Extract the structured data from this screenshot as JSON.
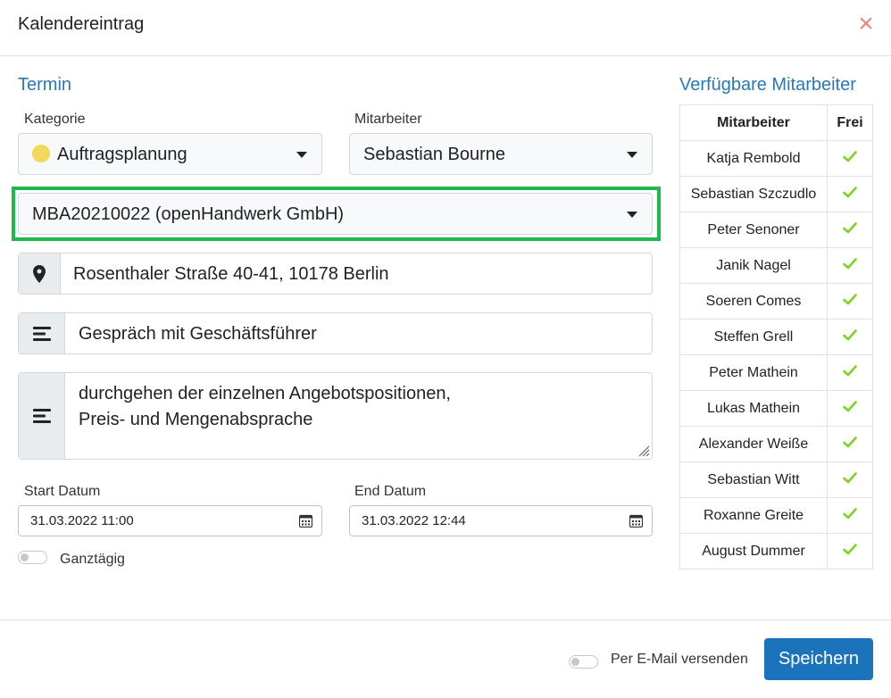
{
  "dialog": {
    "title": "Kalendereintrag",
    "close_symbol": "×"
  },
  "termin": {
    "section_title": "Termin",
    "kategorie": {
      "label": "Kategorie",
      "value": "Auftragsplanung",
      "dot_color": "#f3d85c"
    },
    "mitarbeiter": {
      "label": "Mitarbeiter",
      "value": "Sebastian Bourne"
    },
    "auftrag": {
      "value": "MBA20210022 (openHandwerk GmbH)",
      "highlight_color": "#1fb84f"
    },
    "address": {
      "icon": "map-marker-icon",
      "value": "Rosenthaler Straße 40-41, 10178 Berlin"
    },
    "subject": {
      "icon": "align-justify-icon",
      "value": "Gespräch mit Geschäftsführer"
    },
    "description": {
      "icon": "align-justify-icon",
      "lines": [
        "durchgehen der einzelnen Angebotspositionen,",
        "Preis- und Mengenabsprache"
      ]
    },
    "start": {
      "label": "Start Datum",
      "value": "31.03.2022 11:00"
    },
    "end": {
      "label": "End Datum",
      "value": "31.03.2022 12:44"
    },
    "ganztaegig": {
      "label": "Ganztägig",
      "checked": false
    }
  },
  "staff": {
    "section_title": "Verfügbare Mitarbeiter",
    "headers": [
      "Mitarbeiter",
      "Frei"
    ],
    "check_color": "#7ed321",
    "rows": [
      {
        "name": "Katja Rembold",
        "free": true
      },
      {
        "name": "Sebastian Szczudlo",
        "free": true
      },
      {
        "name": "Peter Senoner",
        "free": true
      },
      {
        "name": "Janik Nagel",
        "free": true
      },
      {
        "name": "Soeren Comes",
        "free": true
      },
      {
        "name": "Steffen Grell",
        "free": true
      },
      {
        "name": "Peter Mathein",
        "free": true
      },
      {
        "name": "Lukas Mathein",
        "free": true
      },
      {
        "name": "Alexander Weiße",
        "free": true
      },
      {
        "name": "Sebastian Witt",
        "free": true
      },
      {
        "name": "Roxanne Greite",
        "free": true
      },
      {
        "name": "August Dummer",
        "free": true
      }
    ]
  },
  "footer": {
    "email_toggle_label": "Per E-Mail versenden",
    "email_checked": false,
    "save_label": "Speichern",
    "accent": "#1a73bb"
  }
}
